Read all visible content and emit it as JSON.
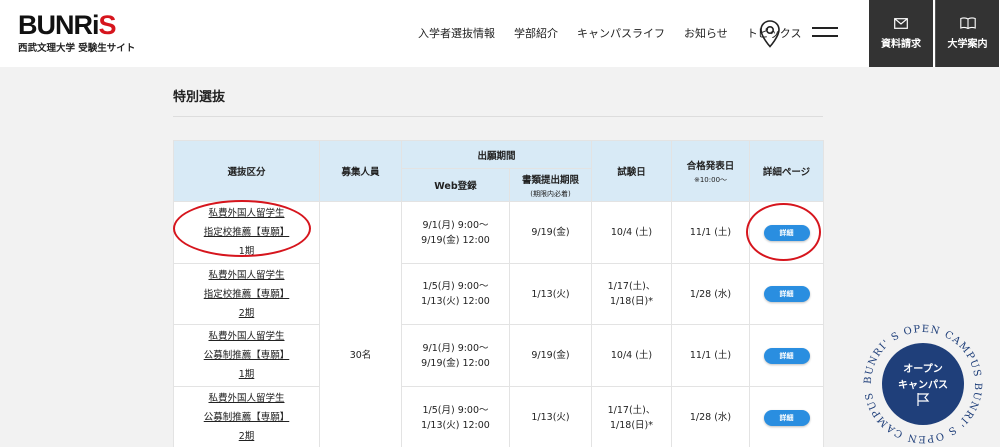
{
  "header": {
    "logo_main_a": "BUNRi",
    "logo_main_b": "S",
    "logo_sub": "西武文理大学 受験生サイト",
    "nav": [
      "入学者選抜情報",
      "学部紹介",
      "キャンパスライフ",
      "お知らせ",
      "トピックス"
    ],
    "request_label": "資料請求",
    "guide_label": "大学案内"
  },
  "section": {
    "title": "特別選抜"
  },
  "table": {
    "headers": {
      "category": "選抜区分",
      "capacity": "募集人員",
      "period": "出願期間",
      "web": "Web登録",
      "docs": "書類提出期限",
      "docs_note": "(期限内必着)",
      "exam": "試験日",
      "result": "合格発表日",
      "result_note": "※10:00〜",
      "detail": "詳細ページ"
    },
    "capacity": "30名",
    "detail_label": "詳細",
    "rows": [
      {
        "cat1": "私費外国人留学生",
        "cat2": "指定校推薦【専願】",
        "cat3": "1期",
        "web1": "9/1(月) 9:00〜",
        "web2": "9/19(金) 12:00",
        "docs": "9/19(金)",
        "exam1": "10/4 (土)",
        "exam2": "",
        "result": "11/1 (土)"
      },
      {
        "cat1": "私費外国人留学生",
        "cat2": "指定校推薦【専願】",
        "cat3": "2期",
        "web1": "1/5(月) 9:00〜",
        "web2": "1/13(火) 12:00",
        "docs": "1/13(火)",
        "exam1": "1/17(土)、",
        "exam2": "1/18(日)*",
        "result": "1/28 (水)"
      },
      {
        "cat1": "私費外国人留学生",
        "cat2": "公募制推薦【専願】",
        "cat3": "1期",
        "web1": "9/1(月) 9:00〜",
        "web2": "9/19(金) 12:00",
        "docs": "9/19(金)",
        "exam1": "10/4 (土)",
        "exam2": "",
        "result": "11/1 (土)"
      },
      {
        "cat1": "私費外国人留学生",
        "cat2": "公募制推薦【専願】",
        "cat3": "2期",
        "web1": "1/5(月) 9:00〜",
        "web2": "1/13(火) 12:00",
        "docs": "1/13(火)",
        "exam1": "1/17(土)、",
        "exam2": "1/18(日)*",
        "result": "1/28 (水)"
      }
    ]
  },
  "open_campus": {
    "line1": "オープン",
    "line2": "キャンパス",
    "ring_text": "BUNRI' S OPEN CAMPUS BUNRI' S OPEN CAMPUS"
  },
  "colors": {
    "accent": "#2a8ee0",
    "brand_red": "#d6151d",
    "header_dark": "#333333",
    "badge_navy": "#1f3f7a",
    "table_head": "#d8eaf6"
  }
}
